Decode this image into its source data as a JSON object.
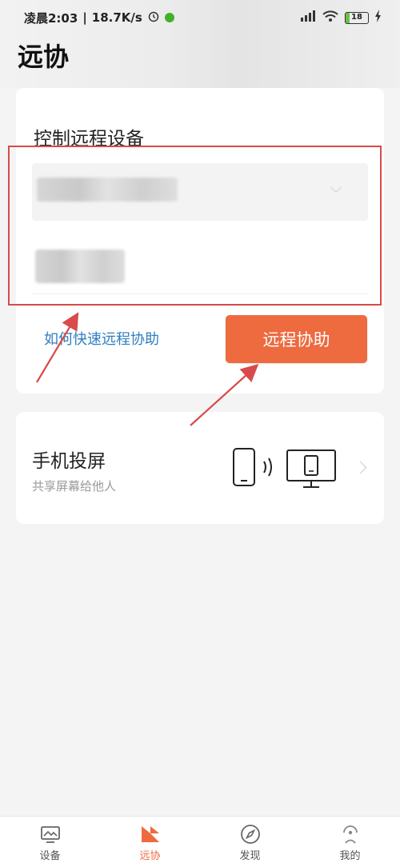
{
  "status_bar": {
    "time": "凌晨2:03",
    "network_speed": "18.7K/s",
    "battery": "18"
  },
  "page": {
    "title": "远协"
  },
  "remote_card": {
    "heading": "控制远程设备",
    "help_link": "如何快速远程协助",
    "assist_button": "远程协助"
  },
  "cast_card": {
    "title": "手机投屏",
    "subtitle": "共享屏幕给他人"
  },
  "tabbar": {
    "items": [
      {
        "label": "设备",
        "icon": "monitor-icon"
      },
      {
        "label": "远协",
        "icon": "remote-assist-icon"
      },
      {
        "label": "发现",
        "icon": "compass-icon"
      },
      {
        "label": "我的",
        "icon": "profile-icon"
      }
    ],
    "active": "远协"
  },
  "colors": {
    "accent": "#ee6a3f",
    "link": "#2f7ec0",
    "annotation": "#d94a4a"
  }
}
